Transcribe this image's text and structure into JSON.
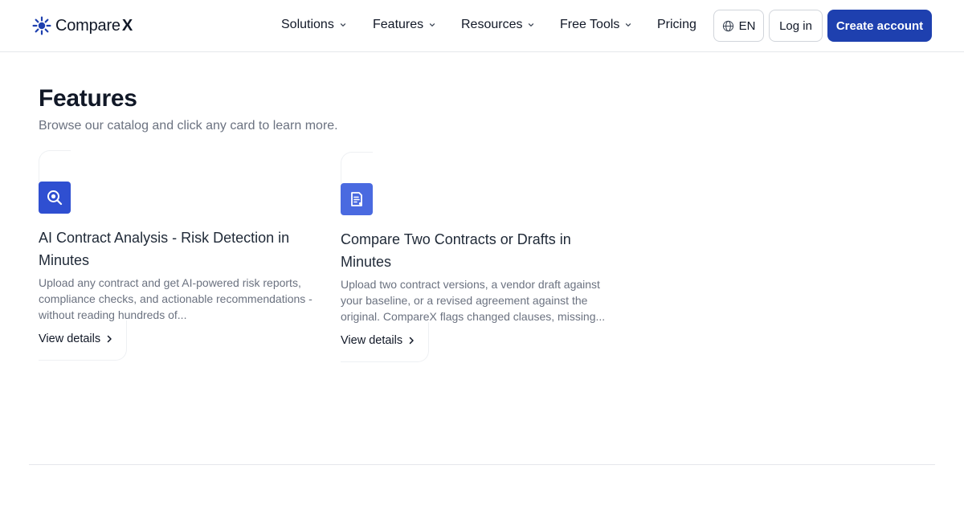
{
  "brand": {
    "name": "Compare",
    "suffix": "X"
  },
  "nav": {
    "items": [
      {
        "label": "Solutions",
        "has_dropdown": true
      },
      {
        "label": "Features",
        "has_dropdown": true
      },
      {
        "label": "Resources",
        "has_dropdown": true
      },
      {
        "label": "Free Tools",
        "has_dropdown": true
      },
      {
        "label": "Pricing",
        "has_dropdown": false
      }
    ],
    "language": "EN",
    "login_label": "Log in",
    "create_account_label": "Create account"
  },
  "page": {
    "title": "Features",
    "subtitle": "Browse our catalog and click any card to learn more."
  },
  "cards": [
    {
      "icon": "magnifier-icon",
      "icon_color": "#2f4fd1",
      "title": "AI Contract Analysis - Risk Detection in Minutes",
      "description": "Upload any contract and get AI-powered risk reports, compliance checks, and actionable recommendations - without reading hundreds of...",
      "link_label": "View details"
    },
    {
      "icon": "document-icon",
      "icon_color": "#4a6ae0",
      "title": "Compare Two Contracts or Drafts in Minutes",
      "description": "Upload two contract versions, a vendor draft against your baseline, or a revised agreement against the original. CompareX flags changed clauses, missing...",
      "link_label": "View details"
    }
  ],
  "colors": {
    "primary": "#1e40af",
    "text": "#111827",
    "muted": "#6b7280",
    "border": "#e5e7eb"
  }
}
